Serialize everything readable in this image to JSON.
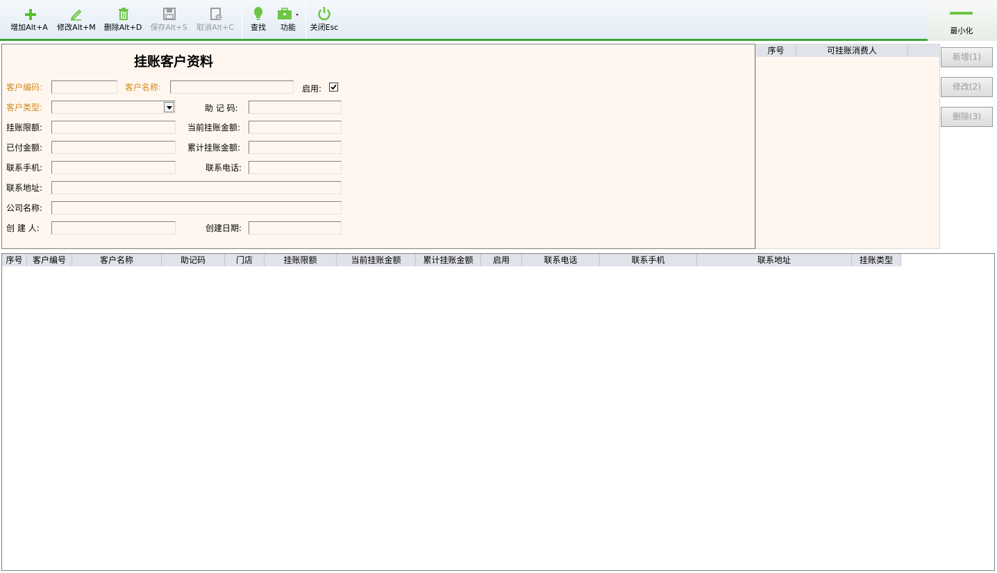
{
  "toolbar": {
    "add": "增加Alt+A",
    "edit": "修改Alt+M",
    "delete": "删除Alt+D",
    "save": "保存Alt+S",
    "cancel": "取消Alt+C",
    "find": "查找",
    "functions": "功能",
    "close": "关闭Esc",
    "minimize": "最小化"
  },
  "colors": {
    "accent_green": "#6cc644",
    "required_label": "#d08a1c",
    "panel_bg": "#fff7ef"
  },
  "form": {
    "title": "挂账客户资料",
    "customer_code_label": "客户编码:",
    "customer_name_label": "客户名称:",
    "enabled_label": "启用:",
    "enabled_checked": true,
    "customer_type_label": "客户类型:",
    "mnemonic_label": "助 记 码:",
    "credit_limit_label": "挂账限额:",
    "current_amount_label": "当前挂账金额:",
    "paid_amount_label": "已付金额:",
    "total_amount_label": "累计挂账金额:",
    "mobile_label": "联系手机:",
    "phone_label": "联系电话:",
    "address_label": "联系地址:",
    "company_label": "公司名称:",
    "creator_label": "创 建 人:",
    "create_date_label": "创建日期:"
  },
  "right_list": {
    "columns": [
      "序号",
      "可挂账消费人"
    ]
  },
  "side_buttons": {
    "new": "新增(1)",
    "edit": "修改(2)",
    "delete": "删除(3)"
  },
  "grid": {
    "columns": [
      "序号",
      "客户编号",
      "客户名称",
      "助记码",
      "门店",
      "挂账限额",
      "当前挂账金额",
      "累计挂账金额",
      "启用",
      "联系电话",
      "联系手机",
      "联系地址",
      "挂账类型"
    ]
  }
}
